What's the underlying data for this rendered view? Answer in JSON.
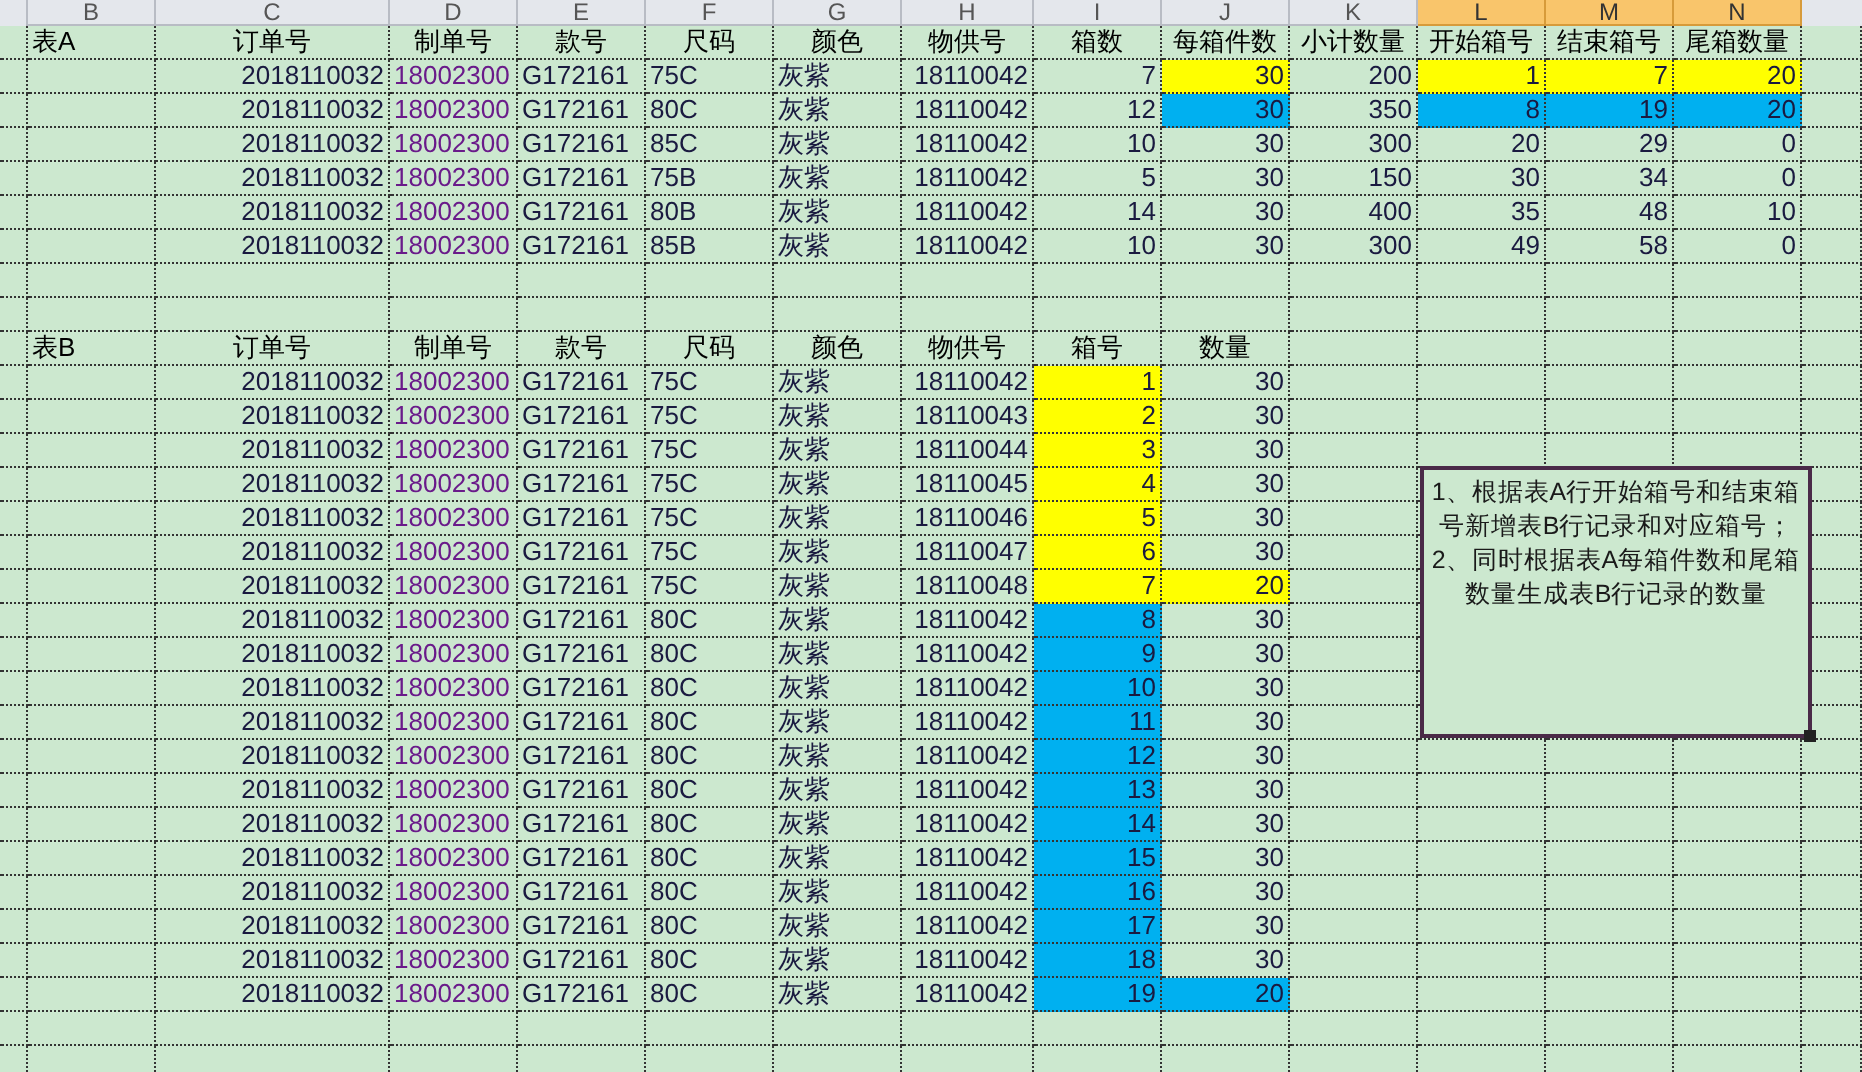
{
  "column_headers": [
    {
      "label": "B",
      "selected": false
    },
    {
      "label": "C",
      "selected": false
    },
    {
      "label": "D",
      "selected": false
    },
    {
      "label": "E",
      "selected": false
    },
    {
      "label": "F",
      "selected": false
    },
    {
      "label": "G",
      "selected": false
    },
    {
      "label": "H",
      "selected": false
    },
    {
      "label": "I",
      "selected": false
    },
    {
      "label": "J",
      "selected": false
    },
    {
      "label": "K",
      "selected": false
    },
    {
      "label": "L",
      "selected": true
    },
    {
      "label": "M",
      "selected": true
    },
    {
      "label": "N",
      "selected": true
    }
  ],
  "table_a": {
    "title": "表A",
    "columns": [
      {
        "label": "订单号",
        "kind": "number"
      },
      {
        "label": "制单号",
        "kind": "id"
      },
      {
        "label": "款号",
        "kind": "text"
      },
      {
        "label": "尺码",
        "kind": "text"
      },
      {
        "label": "颜色",
        "kind": "text"
      },
      {
        "label": "物供号",
        "kind": "number"
      },
      {
        "label": "箱数",
        "kind": "number"
      },
      {
        "label": "每箱件数",
        "kind": "number"
      },
      {
        "label": "小计数量",
        "kind": "number"
      },
      {
        "label": "开始箱号",
        "kind": "number"
      },
      {
        "label": "结束箱号",
        "kind": "number"
      },
      {
        "label": "尾箱数量",
        "kind": "number"
      }
    ],
    "rows": [
      {
        "cells": [
          {
            "text": "2018110032"
          },
          {
            "text": "18002300"
          },
          {
            "text": "G172161"
          },
          {
            "text": "75C"
          },
          {
            "text": "灰紫"
          },
          {
            "text": "18110042"
          },
          {
            "text": "7"
          },
          {
            "text": "30",
            "color": "#ffff00"
          },
          {
            "text": "200"
          },
          {
            "text": "1",
            "color": "#ffff00"
          },
          {
            "text": "7",
            "color": "#ffff00"
          },
          {
            "text": "20",
            "color": "#ffff00"
          }
        ]
      },
      {
        "cells": [
          {
            "text": "2018110032"
          },
          {
            "text": "18002300"
          },
          {
            "text": "G172161"
          },
          {
            "text": "80C"
          },
          {
            "text": "灰紫"
          },
          {
            "text": "18110042"
          },
          {
            "text": "12"
          },
          {
            "text": "30",
            "color": "#00b0f0"
          },
          {
            "text": "350"
          },
          {
            "text": "8",
            "color": "#00b0f0"
          },
          {
            "text": "19",
            "color": "#00b0f0"
          },
          {
            "text": "20",
            "color": "#00b0f0"
          }
        ]
      },
      {
        "cells": [
          {
            "text": "2018110032"
          },
          {
            "text": "18002300"
          },
          {
            "text": "G172161"
          },
          {
            "text": "85C"
          },
          {
            "text": "灰紫"
          },
          {
            "text": "18110042"
          },
          {
            "text": "10"
          },
          {
            "text": "30"
          },
          {
            "text": "300"
          },
          {
            "text": "20"
          },
          {
            "text": "29"
          },
          {
            "text": "0"
          }
        ]
      },
      {
        "cells": [
          {
            "text": "2018110032"
          },
          {
            "text": "18002300"
          },
          {
            "text": "G172161"
          },
          {
            "text": "75B"
          },
          {
            "text": "灰紫"
          },
          {
            "text": "18110042"
          },
          {
            "text": "5"
          },
          {
            "text": "30"
          },
          {
            "text": "150"
          },
          {
            "text": "30"
          },
          {
            "text": "34"
          },
          {
            "text": "0"
          }
        ]
      },
      {
        "cells": [
          {
            "text": "2018110032"
          },
          {
            "text": "18002300"
          },
          {
            "text": "G172161"
          },
          {
            "text": "80B"
          },
          {
            "text": "灰紫"
          },
          {
            "text": "18110042"
          },
          {
            "text": "14"
          },
          {
            "text": "30"
          },
          {
            "text": "400"
          },
          {
            "text": "35"
          },
          {
            "text": "48"
          },
          {
            "text": "10"
          }
        ]
      },
      {
        "cells": [
          {
            "text": "2018110032"
          },
          {
            "text": "18002300"
          },
          {
            "text": "G172161"
          },
          {
            "text": "85B"
          },
          {
            "text": "灰紫"
          },
          {
            "text": "18110042"
          },
          {
            "text": "10"
          },
          {
            "text": "30"
          },
          {
            "text": "300"
          },
          {
            "text": "49"
          },
          {
            "text": "58"
          },
          {
            "text": "0"
          }
        ]
      }
    ]
  },
  "table_b": {
    "title": "表B",
    "columns": [
      {
        "label": "订单号",
        "kind": "number"
      },
      {
        "label": "制单号",
        "kind": "id"
      },
      {
        "label": "款号",
        "kind": "text"
      },
      {
        "label": "尺码",
        "kind": "text"
      },
      {
        "label": "颜色",
        "kind": "text"
      },
      {
        "label": "物供号",
        "kind": "number"
      },
      {
        "label": "箱号",
        "kind": "number"
      },
      {
        "label": "数量",
        "kind": "number"
      }
    ],
    "rows": [
      {
        "cells": [
          {
            "text": "2018110032"
          },
          {
            "text": "18002300"
          },
          {
            "text": "G172161"
          },
          {
            "text": "75C"
          },
          {
            "text": "灰紫"
          },
          {
            "text": "18110042"
          },
          {
            "text": "1",
            "color": "#ffff00"
          },
          {
            "text": "30"
          }
        ]
      },
      {
        "cells": [
          {
            "text": "2018110032"
          },
          {
            "text": "18002300"
          },
          {
            "text": "G172161"
          },
          {
            "text": "75C"
          },
          {
            "text": "灰紫"
          },
          {
            "text": "18110043"
          },
          {
            "text": "2",
            "color": "#ffff00"
          },
          {
            "text": "30"
          }
        ]
      },
      {
        "cells": [
          {
            "text": "2018110032"
          },
          {
            "text": "18002300"
          },
          {
            "text": "G172161"
          },
          {
            "text": "75C"
          },
          {
            "text": "灰紫"
          },
          {
            "text": "18110044"
          },
          {
            "text": "3",
            "color": "#ffff00"
          },
          {
            "text": "30"
          }
        ]
      },
      {
        "cells": [
          {
            "text": "2018110032"
          },
          {
            "text": "18002300"
          },
          {
            "text": "G172161"
          },
          {
            "text": "75C"
          },
          {
            "text": "灰紫"
          },
          {
            "text": "18110045"
          },
          {
            "text": "4",
            "color": "#ffff00"
          },
          {
            "text": "30"
          }
        ]
      },
      {
        "cells": [
          {
            "text": "2018110032"
          },
          {
            "text": "18002300"
          },
          {
            "text": "G172161"
          },
          {
            "text": "75C"
          },
          {
            "text": "灰紫"
          },
          {
            "text": "18110046"
          },
          {
            "text": "5",
            "color": "#ffff00"
          },
          {
            "text": "30"
          }
        ]
      },
      {
        "cells": [
          {
            "text": "2018110032"
          },
          {
            "text": "18002300"
          },
          {
            "text": "G172161"
          },
          {
            "text": "75C"
          },
          {
            "text": "灰紫"
          },
          {
            "text": "18110047"
          },
          {
            "text": "6",
            "color": "#ffff00"
          },
          {
            "text": "30"
          }
        ]
      },
      {
        "cells": [
          {
            "text": "2018110032"
          },
          {
            "text": "18002300"
          },
          {
            "text": "G172161"
          },
          {
            "text": "75C"
          },
          {
            "text": "灰紫"
          },
          {
            "text": "18110048"
          },
          {
            "text": "7",
            "color": "#ffff00"
          },
          {
            "text": "20",
            "color": "#ffff00"
          }
        ]
      },
      {
        "cells": [
          {
            "text": "2018110032"
          },
          {
            "text": "18002300"
          },
          {
            "text": "G172161"
          },
          {
            "text": "80C"
          },
          {
            "text": "灰紫"
          },
          {
            "text": "18110042"
          },
          {
            "text": "8",
            "color": "#00b0f0"
          },
          {
            "text": "30"
          }
        ]
      },
      {
        "cells": [
          {
            "text": "2018110032"
          },
          {
            "text": "18002300"
          },
          {
            "text": "G172161"
          },
          {
            "text": "80C"
          },
          {
            "text": "灰紫"
          },
          {
            "text": "18110042"
          },
          {
            "text": "9",
            "color": "#00b0f0"
          },
          {
            "text": "30"
          }
        ]
      },
      {
        "cells": [
          {
            "text": "2018110032"
          },
          {
            "text": "18002300"
          },
          {
            "text": "G172161"
          },
          {
            "text": "80C"
          },
          {
            "text": "灰紫"
          },
          {
            "text": "18110042"
          },
          {
            "text": "10",
            "color": "#00b0f0"
          },
          {
            "text": "30"
          }
        ]
      },
      {
        "cells": [
          {
            "text": "2018110032"
          },
          {
            "text": "18002300"
          },
          {
            "text": "G172161"
          },
          {
            "text": "80C"
          },
          {
            "text": "灰紫"
          },
          {
            "text": "18110042"
          },
          {
            "text": "11",
            "color": "#00b0f0"
          },
          {
            "text": "30"
          }
        ]
      },
      {
        "cells": [
          {
            "text": "2018110032"
          },
          {
            "text": "18002300"
          },
          {
            "text": "G172161"
          },
          {
            "text": "80C"
          },
          {
            "text": "灰紫"
          },
          {
            "text": "18110042"
          },
          {
            "text": "12",
            "color": "#00b0f0"
          },
          {
            "text": "30"
          }
        ]
      },
      {
        "cells": [
          {
            "text": "2018110032"
          },
          {
            "text": "18002300"
          },
          {
            "text": "G172161"
          },
          {
            "text": "80C"
          },
          {
            "text": "灰紫"
          },
          {
            "text": "18110042"
          },
          {
            "text": "13",
            "color": "#00b0f0"
          },
          {
            "text": "30"
          }
        ]
      },
      {
        "cells": [
          {
            "text": "2018110032"
          },
          {
            "text": "18002300"
          },
          {
            "text": "G172161"
          },
          {
            "text": "80C"
          },
          {
            "text": "灰紫"
          },
          {
            "text": "18110042"
          },
          {
            "text": "14",
            "color": "#00b0f0"
          },
          {
            "text": "30"
          }
        ]
      },
      {
        "cells": [
          {
            "text": "2018110032"
          },
          {
            "text": "18002300"
          },
          {
            "text": "G172161"
          },
          {
            "text": "80C"
          },
          {
            "text": "灰紫"
          },
          {
            "text": "18110042"
          },
          {
            "text": "15",
            "color": "#00b0f0"
          },
          {
            "text": "30"
          }
        ]
      },
      {
        "cells": [
          {
            "text": "2018110032"
          },
          {
            "text": "18002300"
          },
          {
            "text": "G172161"
          },
          {
            "text": "80C"
          },
          {
            "text": "灰紫"
          },
          {
            "text": "18110042"
          },
          {
            "text": "16",
            "color": "#00b0f0"
          },
          {
            "text": "30"
          }
        ]
      },
      {
        "cells": [
          {
            "text": "2018110032"
          },
          {
            "text": "18002300"
          },
          {
            "text": "G172161"
          },
          {
            "text": "80C"
          },
          {
            "text": "灰紫"
          },
          {
            "text": "18110042"
          },
          {
            "text": "17",
            "color": "#00b0f0"
          },
          {
            "text": "30"
          }
        ]
      },
      {
        "cells": [
          {
            "text": "2018110032"
          },
          {
            "text": "18002300"
          },
          {
            "text": "G172161"
          },
          {
            "text": "80C"
          },
          {
            "text": "灰紫"
          },
          {
            "text": "18110042"
          },
          {
            "text": "18",
            "color": "#00b0f0"
          },
          {
            "text": "30"
          }
        ]
      },
      {
        "cells": [
          {
            "text": "2018110032"
          },
          {
            "text": "18002300"
          },
          {
            "text": "G172161"
          },
          {
            "text": "80C"
          },
          {
            "text": "灰紫"
          },
          {
            "text": "18110042"
          },
          {
            "text": "19",
            "color": "#00b0f0"
          },
          {
            "text": "20",
            "color": "#00b0f0"
          }
        ]
      }
    ]
  },
  "note_box": {
    "lines": [
      "1、根据表A行开始箱号和结束箱号新增表B行记录和对应箱号；",
      "2、同时根据表A每箱件数和尾箱数量生成表B行记录的数量"
    ]
  }
}
